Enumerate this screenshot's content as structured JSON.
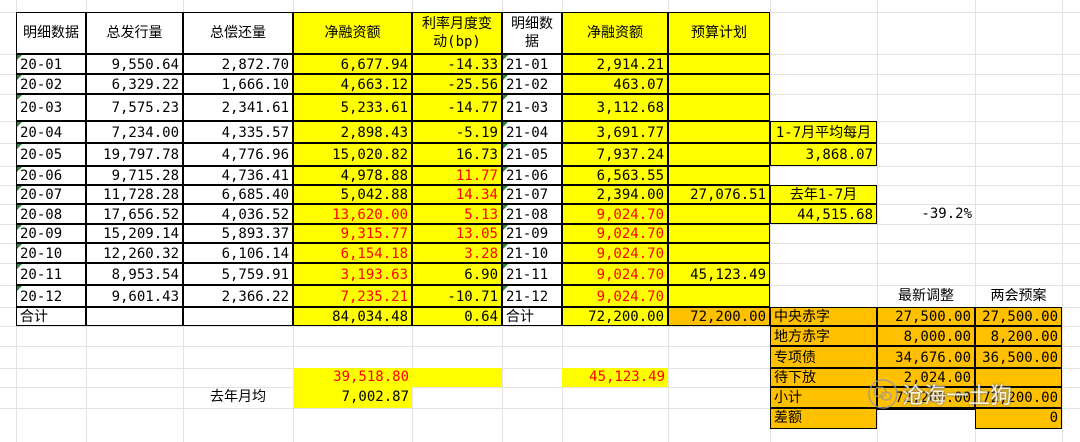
{
  "headers": {
    "detail": "明细数据",
    "total_issued": "总发行量",
    "total_repaid": "总偿还量",
    "net_financing": "净融资额",
    "rate_change": "利率月度变动(bp)",
    "detail2": "明细数据",
    "net_financing2": "净融资额",
    "budget": "预算计划"
  },
  "rows": [
    {
      "m": "20-01",
      "issued": "9,550.64",
      "repaid": "2,872.70",
      "net": "6,677.94",
      "bp": "-14.33",
      "m2": "21-01",
      "net2": "2,914.21",
      "budget": ""
    },
    {
      "m": "20-02",
      "issued": "6,329.22",
      "repaid": "1,666.10",
      "net": "4,663.12",
      "bp": "-25.56",
      "m2": "21-02",
      "net2": "463.07",
      "budget": ""
    },
    {
      "m": "20-03",
      "issued": "7,575.23",
      "repaid": "2,341.61",
      "net": "5,233.61",
      "bp": "-14.77",
      "m2": "21-03",
      "net2": "3,112.68",
      "budget": ""
    },
    {
      "m": "20-04",
      "issued": "7,234.00",
      "repaid": "4,335.57",
      "net": "2,898.43",
      "bp": "-5.19",
      "m2": "21-04",
      "net2": "3,691.77",
      "budget": ""
    },
    {
      "m": "20-05",
      "issued": "19,797.78",
      "repaid": "4,776.96",
      "net": "15,020.82",
      "bp": "16.73",
      "m2": "21-05",
      "net2": "7,937.24",
      "budget": ""
    },
    {
      "m": "20-06",
      "issued": "9,715.28",
      "repaid": "4,736.41",
      "net": "4,978.88",
      "bp": "11.77",
      "m2": "21-06",
      "net2": "6,563.55",
      "budget": ""
    },
    {
      "m": "20-07",
      "issued": "11,728.28",
      "repaid": "6,685.40",
      "net": "5,042.88",
      "bp": "14.34",
      "m2": "21-07",
      "net2": "2,394.00",
      "budget": "27,076.51"
    },
    {
      "m": "20-08",
      "issued": "17,656.52",
      "repaid": "4,036.52",
      "net": "13,620.00",
      "bp": "5.13",
      "m2": "21-08",
      "net2": "9,024.70",
      "budget": ""
    },
    {
      "m": "20-09",
      "issued": "15,209.14",
      "repaid": "5,893.37",
      "net": "9,315.77",
      "bp": "13.05",
      "m2": "21-09",
      "net2": "9,024.70",
      "budget": ""
    },
    {
      "m": "20-10",
      "issued": "12,260.32",
      "repaid": "6,106.14",
      "net": "6,154.18",
      "bp": "3.28",
      "m2": "21-10",
      "net2": "9,024.70",
      "budget": ""
    },
    {
      "m": "20-11",
      "issued": "8,953.54",
      "repaid": "5,759.91",
      "net": "3,193.63",
      "bp": "6.90",
      "m2": "21-11",
      "net2": "9,024.70",
      "budget": "45,123.49"
    },
    {
      "m": "20-12",
      "issued": "9,601.43",
      "repaid": "2,366.22",
      "net": "7,235.21",
      "bp": "-10.71",
      "m2": "21-12",
      "net2": "9,024.70",
      "budget": ""
    }
  ],
  "total": {
    "label": "合计",
    "net": "84,034.48",
    "bp": "0.64",
    "label2": "合计",
    "net2": "72,200.00",
    "budget": "72,200.00"
  },
  "summary": {
    "net_2020_extra": "39,518.80",
    "net_2021_extra": "45,123.49",
    "last_year_avg_label": "去年月均",
    "last_year_avg": "7,002.87"
  },
  "side": {
    "avg_label": "1-7月平均每月",
    "avg_value": "3,868.07",
    "last_year_label": "去年1-7月",
    "last_year_value": "44,515.68",
    "pct": "-39.2%"
  },
  "deficit": {
    "col1": "最新调整",
    "col2": "两会预案",
    "rows": [
      {
        "label": "中央赤字",
        "v1": "27,500.00",
        "v2": "27,500.00"
      },
      {
        "label": "地方赤字",
        "v1": "8,000.00",
        "v2": "8,200.00"
      },
      {
        "label": "专项债",
        "v1": "34,676.00",
        "v2": "36,500.00"
      },
      {
        "label": "待下放",
        "v1": "2,024.00",
        "v2": ""
      },
      {
        "label": "小计",
        "v1": "72,200.00",
        "v2": "72,200.00"
      },
      {
        "label": "差额",
        "v1": "",
        "v2": "0"
      }
    ]
  },
  "watermark": {
    "text": "沧海一土狗",
    "icon": "wechat-icon"
  },
  "colors": {
    "yellow": "#ffff00",
    "orange": "#ffc000",
    "red": "#ff0000",
    "triangle": "#1f8a3a"
  }
}
